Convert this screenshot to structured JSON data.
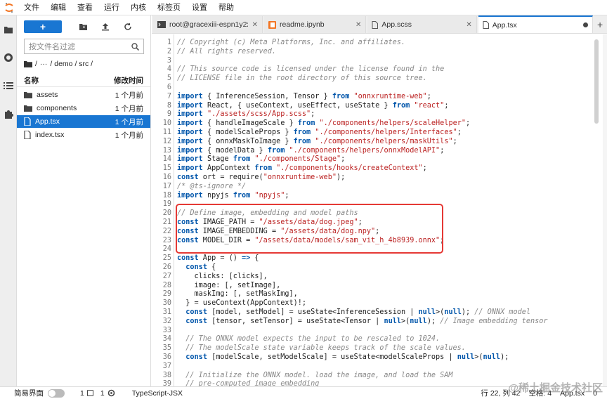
{
  "menu": [
    "文件",
    "编辑",
    "查看",
    "运行",
    "内核",
    "标签页",
    "设置",
    "帮助"
  ],
  "filebrowser": {
    "new_label": "+",
    "filter_placeholder": "按文件名过滤",
    "breadcrumb": [
      "/",
      "···",
      "/ demo / src /"
    ],
    "col_name": "名称",
    "col_modified": "修改时间",
    "files": [
      {
        "name": "assets",
        "type": "folder",
        "modified": "1 个月前"
      },
      {
        "name": "components",
        "type": "folder",
        "modified": "1 个月前"
      },
      {
        "name": "App.tsx",
        "type": "tsx",
        "modified": "1 个月前",
        "selected": true
      },
      {
        "name": "index.tsx",
        "type": "file",
        "modified": "1 个月前"
      }
    ]
  },
  "tabs": [
    {
      "label": "root@gracexiii-espn1y2xt",
      "icon": "terminal"
    },
    {
      "label": "readme.ipynb",
      "icon": "notebook"
    },
    {
      "label": "App.scss",
      "icon": "file"
    },
    {
      "label": "App.tsx",
      "icon": "file",
      "active": true
    }
  ],
  "code_lines": [
    "// Copyright (c) Meta Platforms, Inc. and affiliates.",
    "// All rights reserved.",
    "",
    "// This source code is licensed under the license found in the",
    "// LICENSE file in the root directory of this source tree.",
    "",
    "import { InferenceSession, Tensor } from \"onnxruntime-web\";",
    "import React, { useContext, useEffect, useState } from \"react\";",
    "import \"./assets/scss/App.scss\";",
    "import { handleImageScale } from \"./components/helpers/scaleHelper\";",
    "import { modelScaleProps } from \"./components/helpers/Interfaces\";",
    "import { onnxMaskToImage } from \"./components/helpers/maskUtils\";",
    "import { modelData } from \"./components/helpers/onnxModelAPI\";",
    "import Stage from \"./components/Stage\";",
    "import AppContext from \"./components/hooks/createContext\";",
    "const ort = require(\"onnxruntime-web\");",
    "/* @ts-ignore */",
    "import npyjs from \"npyjs\";",
    "",
    "// Define image, embedding and model paths",
    "const IMAGE_PATH = \"/assets/data/dog.jpeg\";",
    "const IMAGE_EMBEDDING = \"/assets/data/dog.npy\";",
    "const MODEL_DIR = \"/assets/data/models/sam_vit_h_4b8939.onnx\";",
    "",
    "const App = () => {",
    "  const {",
    "    clicks: [clicks],",
    "    image: [, setImage],",
    "    maskImg: [, setMaskImg],",
    "  } = useContext(AppContext)!;",
    "  const [model, setModel] = useState<InferenceSession | null>(null); // ONNX model",
    "  const [tensor, setTensor] = useState<Tensor | null>(null); // Image embedding tensor",
    "",
    "  // The ONNX model expects the input to be rescaled to 1024.",
    "  // The modelScale state variable keeps track of the scale values.",
    "  const [modelScale, setModelScale] = useState<modelScaleProps | null>(null);",
    "",
    "  // Initialize the ONNX model. load the image, and load the SAM",
    "  // pre-computed image embedding"
  ],
  "status": {
    "simple_mode": "简易界面",
    "count1": "1",
    "count2": "1",
    "language": "TypeScript-JSX",
    "cursor": "行 22, 列 42",
    "spaces": "空格: 4",
    "filename": "App.tsx",
    "zero": "0"
  },
  "watermark": "@稀土掘金技术社区",
  "colors": {
    "accent": "#1976d2",
    "highlight": "#e53935"
  }
}
